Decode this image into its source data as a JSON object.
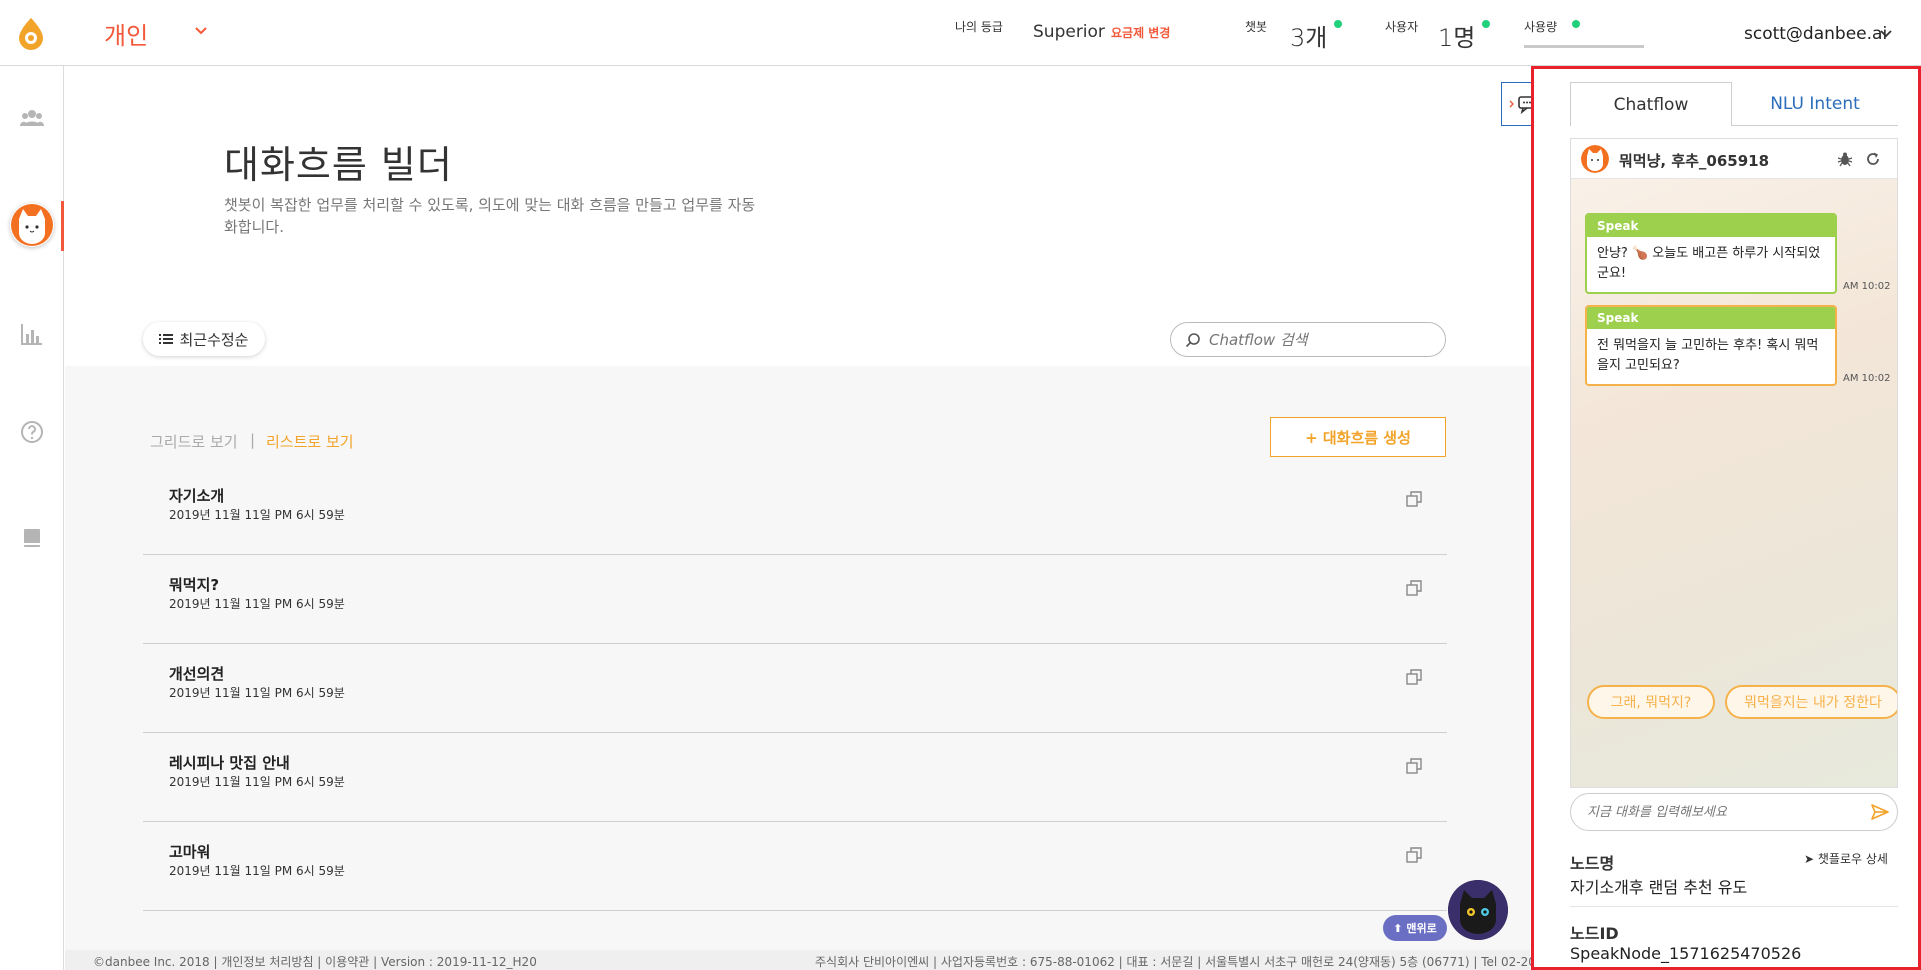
{
  "header": {
    "workspace_label": "개인",
    "grade_label": "나의 등급",
    "plan_name": "Superior",
    "plan_change": "요금제 변경",
    "chatbot_label": "챗봇",
    "chatbot_count": "3개",
    "user_label": "사용자",
    "user_count": "1명",
    "usage_label": "사용량",
    "email": "scott@danbee.ai",
    "status_color": "#21d07a",
    "accent_color": "#f2583a"
  },
  "sidebar": {
    "items": [
      {
        "icon": "users-icon",
        "active": false
      },
      {
        "icon": "bot-avatar-icon",
        "active": true
      },
      {
        "icon": "bar-chart-icon",
        "active": false
      },
      {
        "icon": "help-icon",
        "active": false
      },
      {
        "icon": "book-icon",
        "active": false
      }
    ]
  },
  "main": {
    "title": "대화흐름 빌더",
    "description": "챗봇이 복잡한 업무를 처리할 수 있도록, 의도에 맞는 대화 흐름을 만들고 업무를 자동화합니다.",
    "sort_label": "최근수정순",
    "search_placeholder": "Chatflow 검색",
    "view_grid": "그리드로 보기",
    "view_separator": "|",
    "view_list": "리스트로 보기",
    "create_button": "+ 대화흐름 생성",
    "rows": [
      {
        "title": "자기소개",
        "date": "2019년 11월 11일 PM 6시 59분"
      },
      {
        "title": "뭐먹지?",
        "date": "2019년 11월 11일 PM 6시 59분"
      },
      {
        "title": "개선의견",
        "date": "2019년 11월 11일 PM 6시 59분"
      },
      {
        "title": "레시피나 맛집 안내",
        "date": "2019년 11월 11일 PM 6시 59분"
      },
      {
        "title": "고마워",
        "date": "2019년 11월 11일 PM 6시 59분"
      }
    ],
    "top_button": "⬆ 맨위로"
  },
  "footer": {
    "left": "©danbee Inc. 2018 | 개인정보 처리방침 | 이용약관 | Version : 2019-11-12_H20",
    "right": "주식회사 단비아이엔씨 | 사업자등록번호 : 675-88-01062 | 대표 : 서문길 | 서울특별시 서초구 매헌로 24(양재동) 5층 (06771) | Tel 02-20"
  },
  "panel": {
    "tab_chatflow": "Chatflow",
    "tab_nlu": "NLU Intent",
    "bot_name": "뭐먹냥, 후추_065918",
    "messages": [
      {
        "type": "Speak",
        "text": "안냥? 🍗 오늘도 배고픈 하루가 시작되었군요!",
        "time": "AM 10:02"
      },
      {
        "type": "Speak",
        "text": "전 뭐먹을지 늘 고민하는 후추! 혹시 뭐먹을지 고민되요?",
        "time": "AM 10:02"
      }
    ],
    "quick_replies": [
      "그래, 뭐먹지?",
      "뭐먹을지는 내가 정한다"
    ],
    "input_placeholder": "지금 대화를 입력해보세요",
    "node_name_label": "노드명",
    "node_detail_button": "챗플로우 상세",
    "node_name_value": "자기소개후 랜덤 추천 유도",
    "node_id_label": "노드ID",
    "node_id_value": "SpeakNode_1571625470526"
  }
}
